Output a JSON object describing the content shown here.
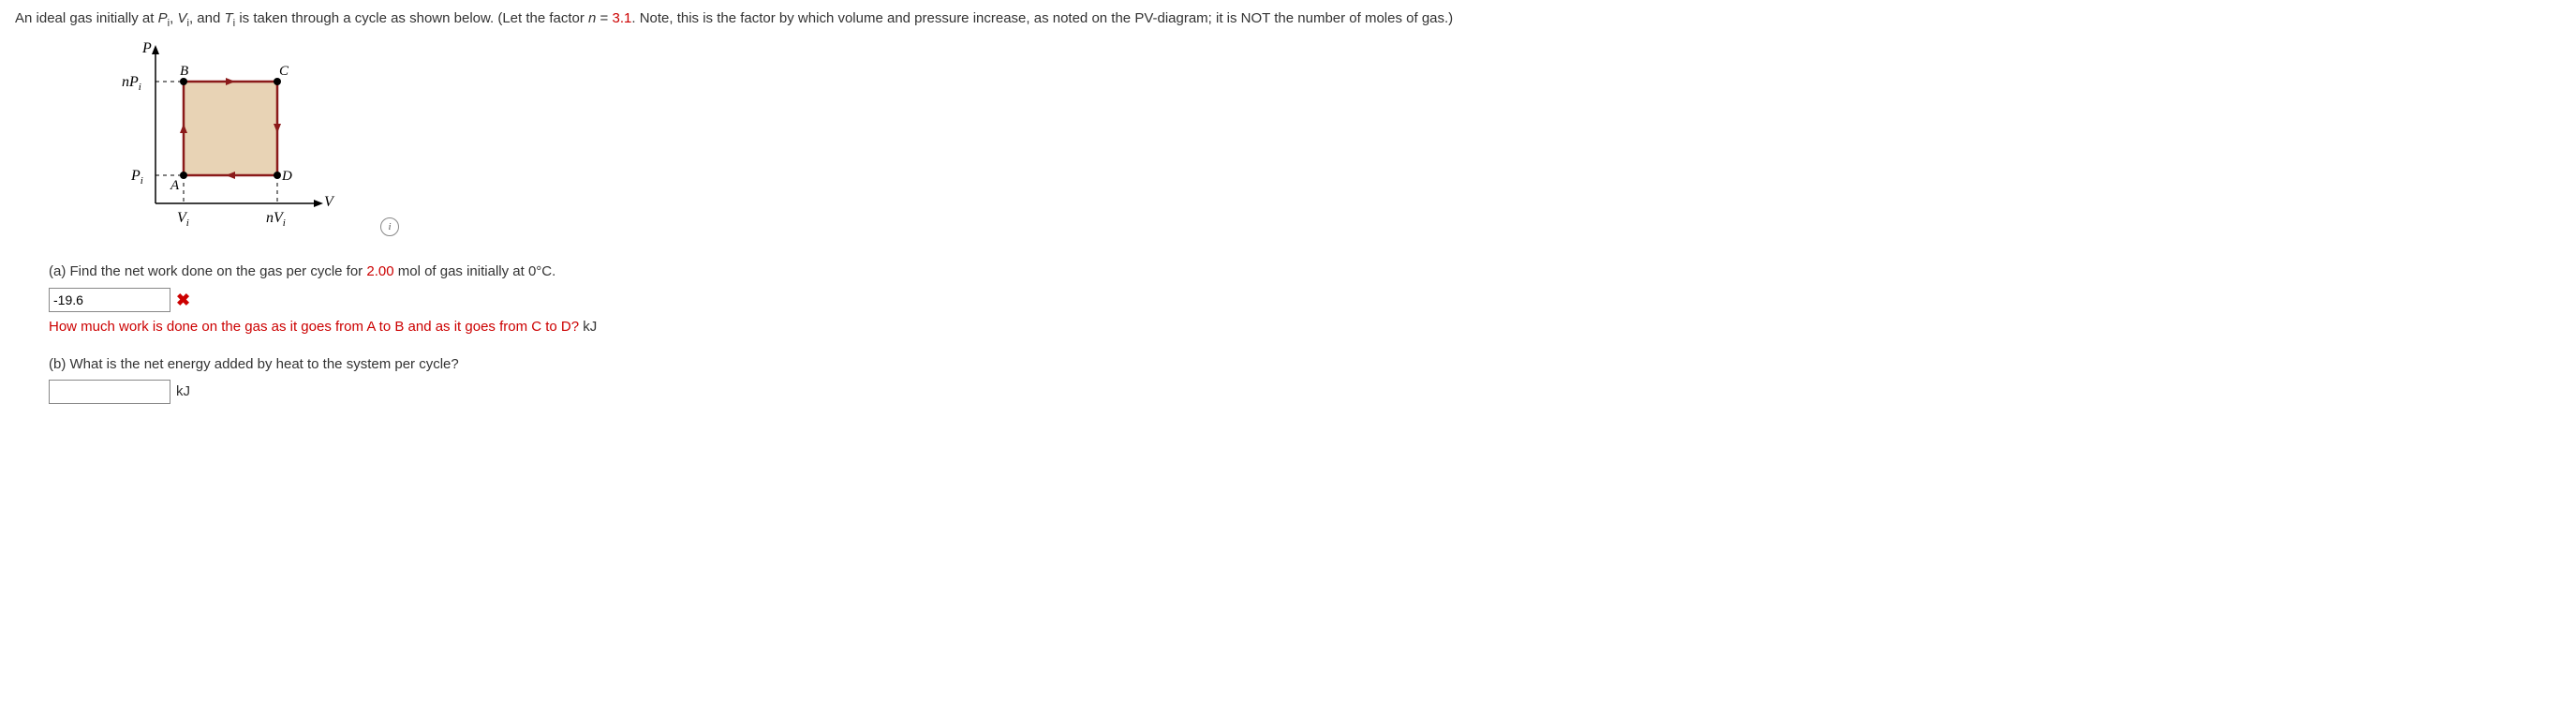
{
  "problem": {
    "intro_pre": "An ideal gas initially at ",
    "sym_Pi": "P",
    "sym_Pi_sub": "i",
    "sep1": ", ",
    "sym_Vi": "V",
    "sym_Vi_sub": "i",
    "sep2": ", and ",
    "sym_Ti": "T",
    "sym_Ti_sub": "i",
    "intro_mid": " is taken through a cycle as shown below. (Let the factor ",
    "sym_n": "n",
    "eq": " = ",
    "n_value": "3.1",
    "intro_post": ". Note, this is the factor by which volume and pressure increase, as noted on the PV-diagram; it is NOT the number of moles of gas.)"
  },
  "diagram": {
    "P": "P",
    "V": "V",
    "nPi": "nP",
    "nPi_sub": "i",
    "Pi": "P",
    "Pi_sub": "i",
    "Vi": "V",
    "Vi_sub": "i",
    "nVi": "nV",
    "nVi_sub": "i",
    "A": "A",
    "B": "B",
    "C": "C",
    "D": "D"
  },
  "part_a": {
    "label": "(a) Find the net work done on the gas per cycle for ",
    "moles": "2.00",
    "label2": " mol of gas initially at 0°C.",
    "answer_value": "-19.6",
    "hint": "How much work is done on the gas as it goes from A to B and as it goes from C to D?",
    "unit": " kJ"
  },
  "part_b": {
    "label": "(b) What is the net energy added by heat to the system per cycle?",
    "answer_value": "",
    "unit": "kJ"
  },
  "chart_data": {
    "type": "pv-cycle",
    "title": "PV diagram of ideal gas cycle",
    "xlabel": "V",
    "ylabel": "P",
    "x_ticks": [
      "V_i",
      "nV_i"
    ],
    "y_ticks": [
      "P_i",
      "nP_i"
    ],
    "n": 3.1,
    "points": [
      {
        "name": "A",
        "V": "V_i",
        "P": "P_i"
      },
      {
        "name": "B",
        "V": "V_i",
        "P": "nP_i"
      },
      {
        "name": "C",
        "V": "nV_i",
        "P": "nP_i"
      },
      {
        "name": "D",
        "V": "nV_i",
        "P": "P_i"
      }
    ],
    "cycle_order": [
      "A",
      "B",
      "C",
      "D",
      "A"
    ],
    "direction": "clockwise",
    "fill": true
  }
}
